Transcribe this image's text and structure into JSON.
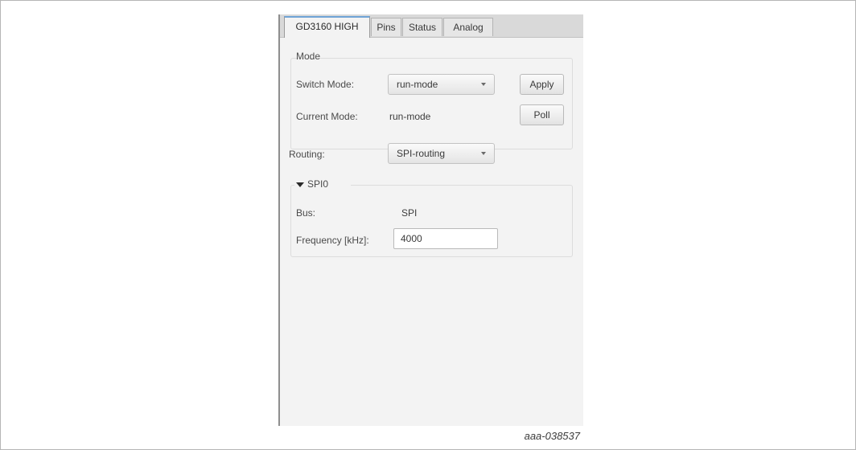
{
  "tabs": [
    {
      "label": "GD3160 HIGH",
      "active": true
    },
    {
      "label": "Pins",
      "active": false
    },
    {
      "label": "Status",
      "active": false
    },
    {
      "label": "Analog",
      "active": false
    }
  ],
  "mode": {
    "title": "Mode",
    "switch_mode_label": "Switch Mode:",
    "switch_mode_value": "run-mode",
    "current_mode_label": "Current Mode:",
    "current_mode_value": "run-mode",
    "apply_label": "Apply",
    "poll_label": "Poll"
  },
  "routing": {
    "label": "Routing:",
    "value": "SPI-routing"
  },
  "spi": {
    "title": "SPI0",
    "expanded": true,
    "bus_label": "Bus:",
    "bus_value": "SPI",
    "frequency_label": "Frequency [kHz]:",
    "frequency_value": "4000"
  },
  "figure_id": "aaa-038537",
  "icons": [
    "dropdown-arrow-icon",
    "collapse-arrow-icon"
  ]
}
